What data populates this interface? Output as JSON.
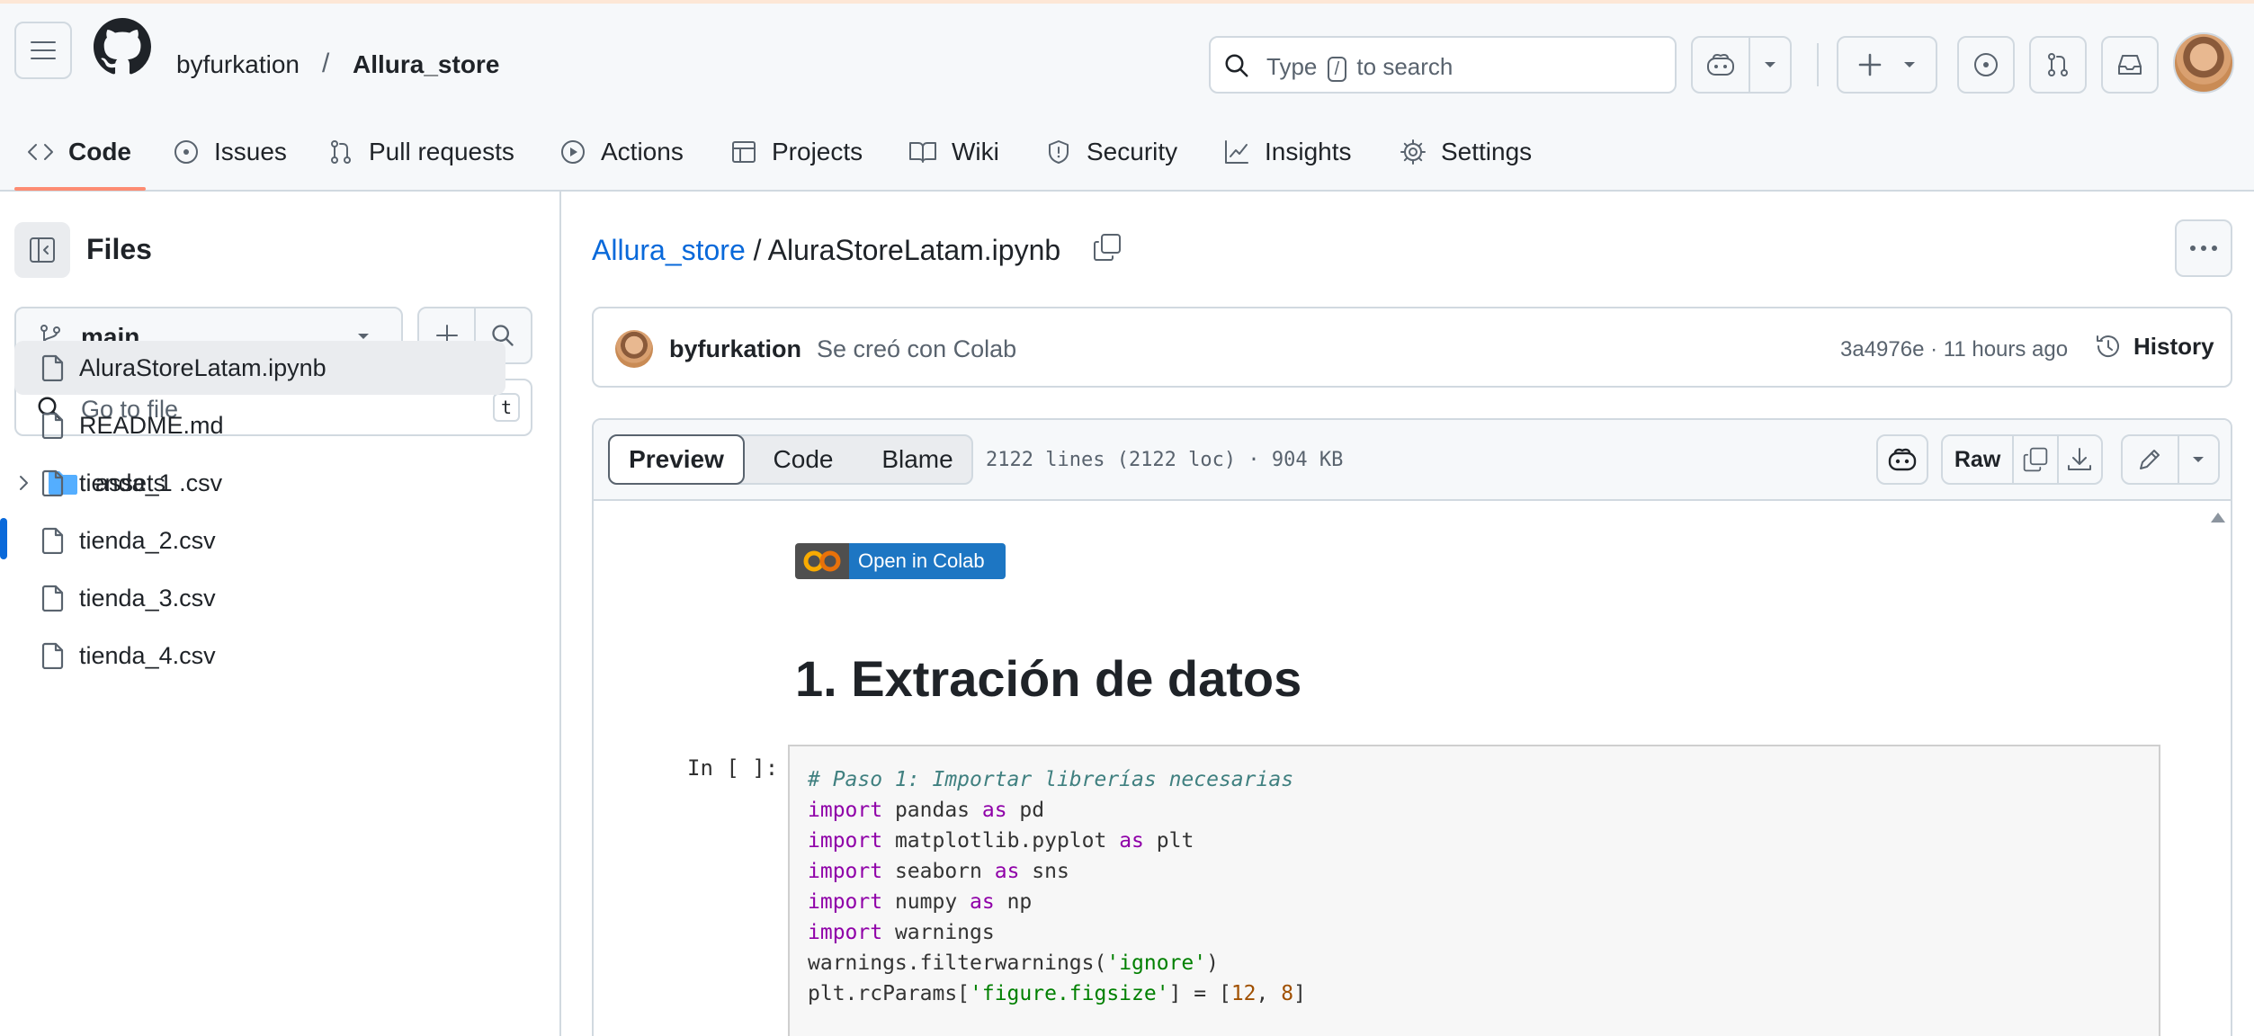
{
  "header": {
    "owner": "byfurkation",
    "separator": "/",
    "repo": "Allura_store",
    "search": {
      "prefix": "Type",
      "key": "/",
      "suffix": "to search"
    }
  },
  "tabs": [
    {
      "label": "Code",
      "icon": "code-icon",
      "active": true
    },
    {
      "label": "Issues",
      "icon": "issue-icon"
    },
    {
      "label": "Pull requests",
      "icon": "pull-request-icon"
    },
    {
      "label": "Actions",
      "icon": "play-icon"
    },
    {
      "label": "Projects",
      "icon": "table-icon"
    },
    {
      "label": "Wiki",
      "icon": "book-icon"
    },
    {
      "label": "Security",
      "icon": "shield-icon"
    },
    {
      "label": "Insights",
      "icon": "graph-icon"
    },
    {
      "label": "Settings",
      "icon": "gear-icon"
    }
  ],
  "sidebar": {
    "title": "Files",
    "branch": "main",
    "goto_placeholder": "Go to file",
    "goto_key": "t",
    "tree": [
      {
        "name": "assets",
        "type": "folder"
      },
      {
        "name": "AluraStoreLatam.ipynb",
        "type": "file",
        "selected": true
      },
      {
        "name": "README.md",
        "type": "file"
      },
      {
        "name": "tienda_1 .csv",
        "type": "file"
      },
      {
        "name": "tienda_2.csv",
        "type": "file"
      },
      {
        "name": "tienda_3.csv",
        "type": "file"
      },
      {
        "name": "tienda_4.csv",
        "type": "file"
      }
    ]
  },
  "breadcrumb": {
    "repo": "Allura_store",
    "sep": "/",
    "file": "AluraStoreLatam.ipynb"
  },
  "commit": {
    "author": "byfurkation",
    "message": "Se creó con Colab",
    "sha_time": "3a4976e · 11 hours ago",
    "history_label": "History"
  },
  "file": {
    "views": [
      "Preview",
      "Code",
      "Blame"
    ],
    "meta": "2122 lines (2122 loc) · 904 KB",
    "raw_label": "Raw"
  },
  "notebook": {
    "colab_label": "Open in Colab",
    "heading": "1. Extración de datos",
    "prompt": "In [ ]:",
    "code_lines": [
      "# Paso 1: Importar librerías necesarias",
      "import pandas as pd",
      "import matplotlib.pyplot as plt",
      "import seaborn as sns",
      "import numpy as np",
      "import warnings",
      "warnings.filterwarnings('ignore')",
      "plt.rcParams['figure.figsize'] = [12, 8]"
    ]
  },
  "colors": {
    "accent_link": "#0969da",
    "tab_underline": "#fd8c73",
    "header_bg": "#f6f8fa",
    "colab_blue": "#1d76c3"
  }
}
